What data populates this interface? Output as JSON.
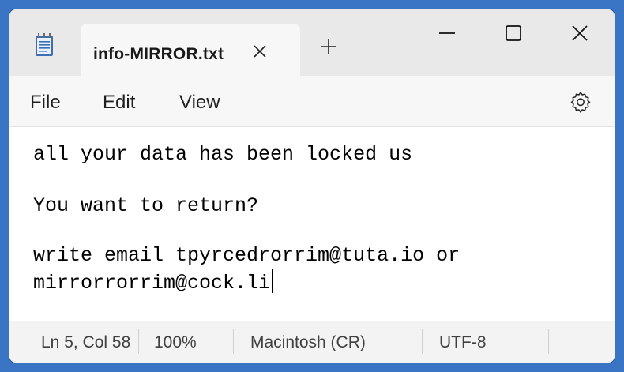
{
  "tab": {
    "title": "info-MIRROR.txt"
  },
  "menu": {
    "file": "File",
    "edit": "Edit",
    "view": "View"
  },
  "icons": {
    "app": "notepad-icon",
    "tab_close": "close-icon",
    "new_tab": "plus-icon",
    "minimize": "minimize-icon",
    "maximize": "maximize-icon",
    "close_window": "close-icon",
    "settings": "gear-icon"
  },
  "editor": {
    "lines": [
      "all your data has been locked us",
      "You want to return?",
      "write email tpyrcedrorrim@tuta.io or",
      "mirrorrorrim@cock.li"
    ]
  },
  "status": {
    "position": "Ln 5, Col 58",
    "zoom": "100%",
    "line_ending": "Macintosh (CR)",
    "encoding": "UTF-8"
  },
  "colors": {
    "background": "#3a74c4",
    "titlebar": "#e9e9e9",
    "editor": "#ffffff"
  }
}
